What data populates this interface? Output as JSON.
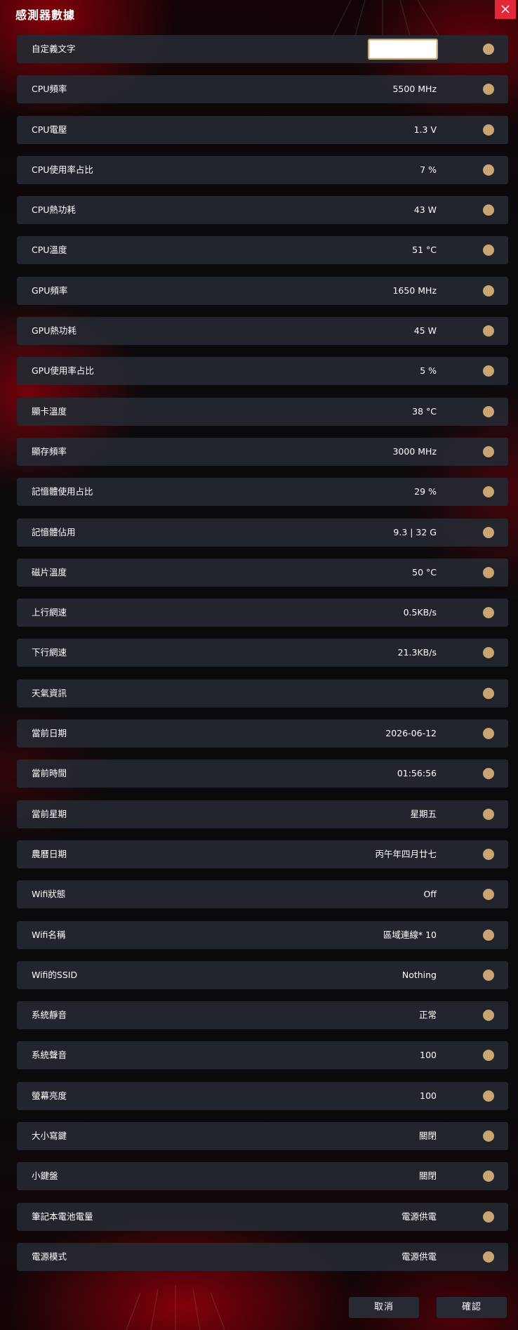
{
  "window": {
    "title": "感測器數據",
    "close_icon": "close-icon"
  },
  "custom_text": {
    "label": "自定義文字",
    "value": ""
  },
  "rows": [
    {
      "label": "CPU頻率",
      "value": "5500 MHz"
    },
    {
      "label": "CPU電壓",
      "value": "1.3 V"
    },
    {
      "label": "CPU使用率占比",
      "value": "7 %"
    },
    {
      "label": "CPU熱功耗",
      "value": "43 W"
    },
    {
      "label": "CPU溫度",
      "value": "51 °C"
    },
    {
      "label": "GPU頻率",
      "value": "1650 MHz"
    },
    {
      "label": "GPU熱功耗",
      "value": "45 W"
    },
    {
      "label": "GPU使用率占比",
      "value": "5 %"
    },
    {
      "label": "顯卡溫度",
      "value": "38 °C"
    },
    {
      "label": "顯存頻率",
      "value": "3000 MHz"
    },
    {
      "label": "記憶體使用占比",
      "value": "29 %"
    },
    {
      "label": "記憶體佔用",
      "value": "9.3 | 32 G"
    },
    {
      "label": "磁片溫度",
      "value": "50 °C"
    },
    {
      "label": "上行網速",
      "value": "0.5KB/s"
    },
    {
      "label": "下行網速",
      "value": "21.3KB/s"
    },
    {
      "label": "天氣資訊",
      "value": ""
    },
    {
      "label": "當前日期",
      "value": "2026-06-12"
    },
    {
      "label": "當前時間",
      "value": "01:56:56"
    },
    {
      "label": "當前星期",
      "value": "星期五"
    },
    {
      "label": "農曆日期",
      "value": "丙午年四月廿七"
    },
    {
      "label": "Wifi狀態",
      "value": "Off"
    },
    {
      "label": "Wifi名稱",
      "value": "區域連線* 10"
    },
    {
      "label": "Wifi的SSID",
      "value": "Nothing"
    },
    {
      "label": "系統靜音",
      "value": "正常"
    },
    {
      "label": "系統聲音",
      "value": "100"
    },
    {
      "label": "螢幕亮度",
      "value": "100"
    },
    {
      "label": "大小寫鍵",
      "value": "關閉"
    },
    {
      "label": "小鍵盤",
      "value": "關閉"
    },
    {
      "label": "筆記本電池電量",
      "value": "電源供電"
    },
    {
      "label": "電源模式",
      "value": "電源供電"
    }
  ],
  "footer": {
    "cancel_label": "取消",
    "confirm_label": "確認"
  },
  "colors": {
    "accent": "#c9a571",
    "close_button": "#e3283a",
    "row_background": "#25282f",
    "background_glow": "#8c000a"
  }
}
